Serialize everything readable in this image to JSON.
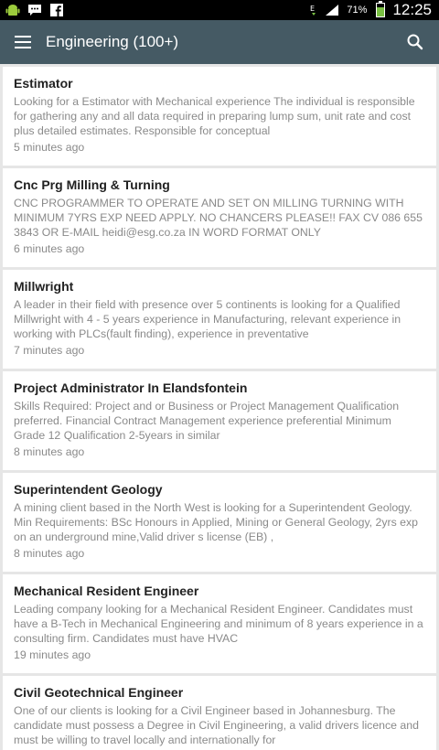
{
  "status_bar": {
    "battery_percent": "71%",
    "battery_level": 0.71,
    "time": "12:25",
    "network_label": "E",
    "left_icons": [
      "android-icon",
      "chat-icon",
      "facebook-icon"
    ]
  },
  "app_bar": {
    "title": "Engineering (100+)"
  },
  "jobs": [
    {
      "title": "Estimator",
      "description": "Looking for a Estimator with Mechanical experience The individual is responsible for gathering any and all data required in preparing lump sum, unit rate and cost plus detailed estimates. Responsible for conceptual",
      "time": "5 minutes ago"
    },
    {
      "title": "Cnc Prg Milling & Turning",
      "description": "CNC PROGRAMMER TO OPERATE AND SET ON MILLING TURNING WITH MINIMUM 7YRS EXP NEED APPLY. NO CHANCERS PLEASE!! FAX CV 086 655 3843 OR E-MAIL heidi@esg.co.za IN WORD FORMAT ONLY",
      "time": "6 minutes ago"
    },
    {
      "title": "Millwright",
      "description": "A leader in their field with presence over 5 continents is looking for a Qualified Millwright with 4 - 5 years experience in Manufacturing, relevant experience in working with PLCs(fault finding), experience in preventative",
      "time": "7 minutes ago"
    },
    {
      "title": "Project Administrator In Elandsfontein",
      "description": "Skills Required: Project and or Business or Project Management Qualification preferred. Financial Contract Management experience preferential Minimum Grade 12 Qualification 2-5years in similar",
      "time": "8 minutes ago"
    },
    {
      "title": "Superintendent Geology",
      "description": "A mining client based in the North West is looking for a Superintendent Geology. Min Requirements: BSc Honours in Applied, Mining or General Geology, 2yrs exp on an underground mine,Valid driver s license (EB) ,",
      "time": "8 minutes ago"
    },
    {
      "title": "Mechanical Resident Engineer",
      "description": "Leading company looking for a Mechanical Resident Engineer. Candidates must have a B-Tech in Mechanical Engineering and minimum of 8 years experience in a consulting firm. Candidates must have HVAC",
      "time": "19 minutes ago"
    },
    {
      "title": "Civil Geotechnical Engineer",
      "description": "One of our clients is looking for a Civil Engineer based in Johannesburg. The candidate must possess a Degree in Civil Engineering, a valid drivers licence and must be willing to travel locally and internationally for",
      "time": ""
    }
  ]
}
